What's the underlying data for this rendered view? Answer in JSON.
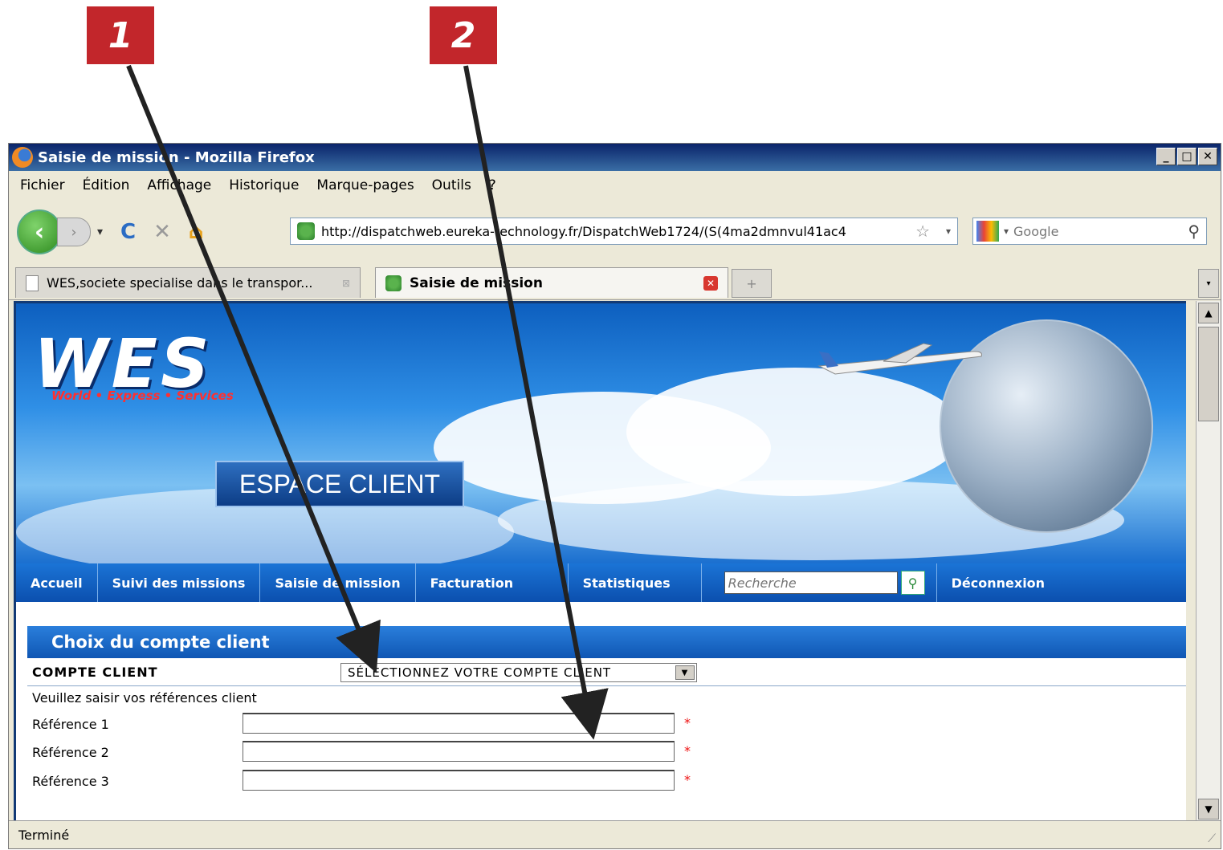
{
  "callouts": [
    "1",
    "2"
  ],
  "window": {
    "title": "Saisie de mission - Mozilla Firefox",
    "controls": {
      "minimize": "_",
      "maximize": "□",
      "close": "✕"
    }
  },
  "menu": [
    "Fichier",
    "Édition",
    "Affichage",
    "Historique",
    "Marque-pages",
    "Outils",
    "?"
  ],
  "navbar": {
    "url": "http://dispatchweb.eureka-technology.fr/DispatchWeb1724/(S(4ma2dmnvul41ac4",
    "search_placeholder": "Google"
  },
  "tabs": [
    {
      "label": "WES,societe specialise dans le transpor...",
      "active": false
    },
    {
      "label": "Saisie de mission",
      "active": true
    }
  ],
  "site": {
    "logo": "WES",
    "tagline": "World • Express • Services",
    "espace": "ESPACE CLIENT",
    "nav": [
      "Accueil",
      "Suivi des missions",
      "Saisie de mission",
      "Facturation",
      "Statistiques"
    ],
    "nav_search_placeholder": "Recherche",
    "logout": "Déconnexion"
  },
  "form": {
    "section_title": "Choix du compte client",
    "compte_label": "COMPTE CLIENT",
    "compte_select_value": "SÉLECTIONNEZ VOTRE COMPTE CLIENT",
    "instruction": "Veuillez saisir vos références client",
    "references": [
      {
        "label": "Référence 1",
        "value": "",
        "required": "*"
      },
      {
        "label": "Référence 2",
        "value": "",
        "required": "*"
      },
      {
        "label": "Référence 3",
        "value": "",
        "required": "*"
      }
    ]
  },
  "status": "Terminé",
  "colors": {
    "callout": "#c2262b",
    "titlebar": "#0a246a",
    "nav": "#0b4fae",
    "required": "#e11111"
  }
}
